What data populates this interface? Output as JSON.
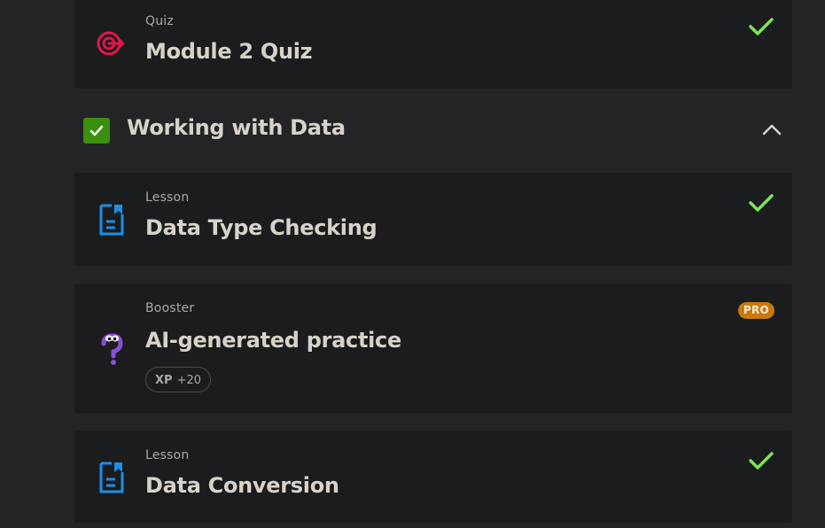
{
  "cards": {
    "quiz": {
      "type": "Quiz",
      "title": "Module 2 Quiz",
      "completed": true,
      "icon": "target-icon"
    },
    "lesson1": {
      "type": "Lesson",
      "title": "Data Type Checking",
      "completed": true,
      "icon": "document-bookmark-icon"
    },
    "booster": {
      "type": "Booster",
      "title": "AI-generated practice",
      "badge": "PRO",
      "xp_label": "XP",
      "xp_value": "+20",
      "icon": "question-mascot-icon"
    },
    "lesson2": {
      "type": "Lesson",
      "title": "Data Conversion",
      "completed": true,
      "icon": "document-bookmark-icon"
    }
  },
  "section": {
    "title": "Working with Data",
    "completed": true,
    "expanded": true
  },
  "colors": {
    "background": "#232425",
    "card": "#1b1c1d",
    "check": "#7ce35c",
    "section_check": "#3a8f0f",
    "quiz_icon": "#e0164e",
    "lesson_icon": "#1d8fe6",
    "booster_icon": "#8a4fd8",
    "pro_badge": "#c87a0a"
  }
}
